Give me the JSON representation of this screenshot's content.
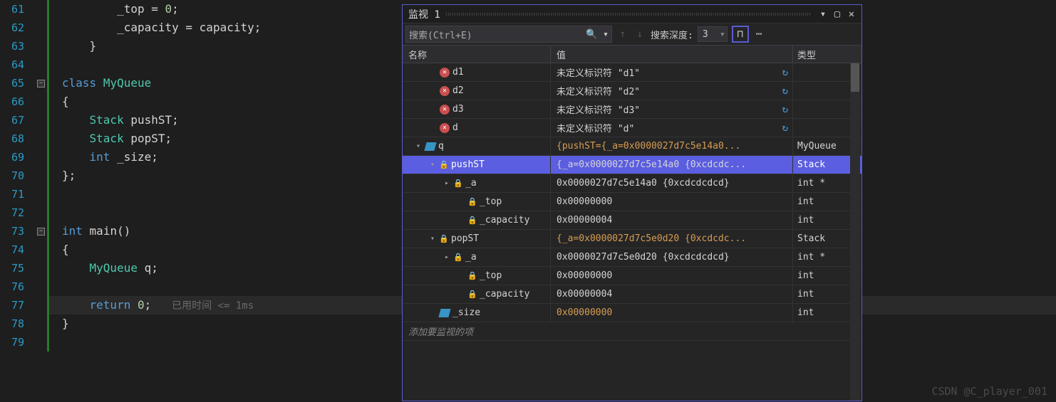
{
  "editor": {
    "lines": [
      {
        "n": "61",
        "code": "        _top = 0;"
      },
      {
        "n": "62",
        "code": "        _capacity = capacity;"
      },
      {
        "n": "63",
        "code": "    }"
      },
      {
        "n": "64",
        "code": ""
      },
      {
        "n": "65",
        "code": "class MyQueue",
        "collapse": true
      },
      {
        "n": "66",
        "code": "{"
      },
      {
        "n": "67",
        "code": "    Stack pushST;"
      },
      {
        "n": "68",
        "code": "    Stack popST;"
      },
      {
        "n": "69",
        "code": "    int _size;"
      },
      {
        "n": "70",
        "code": "};"
      },
      {
        "n": "71",
        "code": ""
      },
      {
        "n": "72",
        "code": ""
      },
      {
        "n": "73",
        "code": "int main()",
        "collapse": true
      },
      {
        "n": "74",
        "code": "{"
      },
      {
        "n": "75",
        "code": "    MyQueue q;"
      },
      {
        "n": "76",
        "code": ""
      },
      {
        "n": "77",
        "code": "    return 0;",
        "current": true,
        "elapsed": "已用时间 <= 1ms"
      },
      {
        "n": "78",
        "code": "}"
      },
      {
        "n": "79",
        "code": ""
      }
    ]
  },
  "watch": {
    "title": "监视 1",
    "search_placeholder": "搜索(Ctrl+E)",
    "depth_label": "搜索深度:",
    "depth_value": "3",
    "columns": {
      "name": "名称",
      "value": "值",
      "type": "类型"
    },
    "add_prompt": "添加要监视的项",
    "rows": [
      {
        "indent": 1,
        "icon": "err",
        "name": "d1",
        "value": "未定义标识符 \"d1\"",
        "type": "",
        "refresh": true
      },
      {
        "indent": 1,
        "icon": "err",
        "name": "d2",
        "value": "未定义标识符 \"d2\"",
        "type": "",
        "refresh": true
      },
      {
        "indent": 1,
        "icon": "err",
        "name": "d3",
        "value": "未定义标识符 \"d3\"",
        "type": "",
        "refresh": true
      },
      {
        "indent": 1,
        "icon": "err",
        "name": "d",
        "value": "未定义标识符 \"d\"",
        "type": "",
        "refresh": true
      },
      {
        "indent": 0,
        "expander": "down",
        "icon": "obj",
        "name": "q",
        "value": "{pushST={_a=0x0000027d7c5e14a0...",
        "type": "MyQueue",
        "vclass": "warn"
      },
      {
        "indent": 1,
        "expander": "down",
        "icon": "lock",
        "name": "pushST",
        "value": "{_a=0x0000027d7c5e14a0 {0xcdcdc...",
        "type": "Stack",
        "selected": true
      },
      {
        "indent": 2,
        "expander": "right",
        "icon": "lock",
        "name": "_a",
        "value": "0x0000027d7c5e14a0 {0xcdcdcdcd}",
        "type": "int *"
      },
      {
        "indent": 3,
        "icon": "lock",
        "name": "_top",
        "value": "0x00000000",
        "type": "int"
      },
      {
        "indent": 3,
        "icon": "lock",
        "name": "_capacity",
        "value": "0x00000004",
        "type": "int"
      },
      {
        "indent": 1,
        "expander": "down",
        "icon": "lock",
        "name": "popST",
        "value": "{_a=0x0000027d7c5e0d20 {0xcdcdc...",
        "type": "Stack",
        "vclass": "warn"
      },
      {
        "indent": 2,
        "expander": "right",
        "icon": "lock",
        "name": "_a",
        "value": "0x0000027d7c5e0d20 {0xcdcdcdcd}",
        "type": "int *"
      },
      {
        "indent": 3,
        "icon": "lock",
        "name": "_top",
        "value": "0x00000000",
        "type": "int"
      },
      {
        "indent": 3,
        "icon": "lock",
        "name": "_capacity",
        "value": "0x00000004",
        "type": "int"
      },
      {
        "indent": 1,
        "icon": "obj",
        "name": "_size",
        "value": "0x00000000",
        "type": "int",
        "vclass": "warn"
      }
    ]
  },
  "watermark": "CSDN @C_player_001"
}
